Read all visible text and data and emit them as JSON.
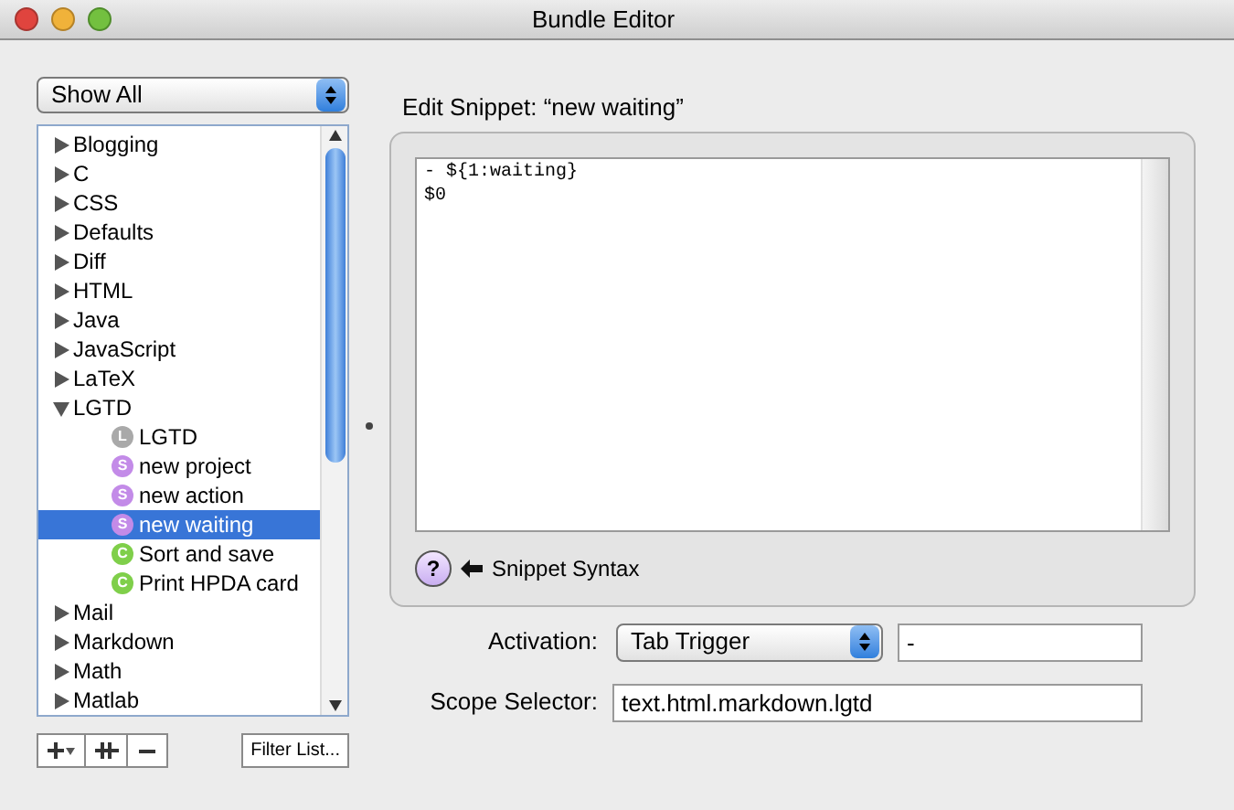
{
  "window": {
    "title": "Bundle Editor"
  },
  "filter_popup": {
    "value": "Show All"
  },
  "bundles": [
    {
      "label": "Blogging",
      "expanded": false,
      "selected": false
    },
    {
      "label": "C",
      "expanded": false,
      "selected": false
    },
    {
      "label": "CSS",
      "expanded": false,
      "selected": false
    },
    {
      "label": "Defaults",
      "expanded": false,
      "selected": false
    },
    {
      "label": "Diff",
      "expanded": false,
      "selected": false
    },
    {
      "label": "HTML",
      "expanded": false,
      "selected": false
    },
    {
      "label": "Java",
      "expanded": false,
      "selected": false
    },
    {
      "label": "JavaScript",
      "expanded": false,
      "selected": false
    },
    {
      "label": "LaTeX",
      "expanded": false,
      "selected": false
    },
    {
      "label": "LGTD",
      "expanded": true,
      "selected": false,
      "children": [
        {
          "label": "LGTD",
          "badge": "L",
          "color": "#a9a9a9",
          "selected": false
        },
        {
          "label": "new project",
          "badge": "S",
          "color": "#c38be8",
          "selected": false
        },
        {
          "label": "new action",
          "badge": "S",
          "color": "#c38be8",
          "selected": false
        },
        {
          "label": "new waiting",
          "badge": "S",
          "color": "#c38be8",
          "selected": true
        },
        {
          "label": "Sort and save",
          "badge": "C",
          "color": "#7fcf4a",
          "selected": false
        },
        {
          "label": "Print HPDA card",
          "badge": "C",
          "color": "#7fcf4a",
          "selected": false
        }
      ]
    },
    {
      "label": "Mail",
      "expanded": false,
      "selected": false
    },
    {
      "label": "Markdown",
      "expanded": false,
      "selected": false
    },
    {
      "label": "Math",
      "expanded": false,
      "selected": false
    },
    {
      "label": "Matlab",
      "expanded": false,
      "selected": false
    }
  ],
  "list_buttons": {
    "filter": "Filter List..."
  },
  "editor": {
    "header": "Edit Snippet: “new waiting”",
    "snippet_lines": [
      "- ${1:waiting}",
      "$0"
    ],
    "help_button": "?",
    "help_link": "Snippet Syntax"
  },
  "activation": {
    "label": "Activation:",
    "value": "Tab Trigger",
    "trigger": "-"
  },
  "scope": {
    "label": "Scope Selector:",
    "value": "text.html.markdown.lgtd"
  }
}
